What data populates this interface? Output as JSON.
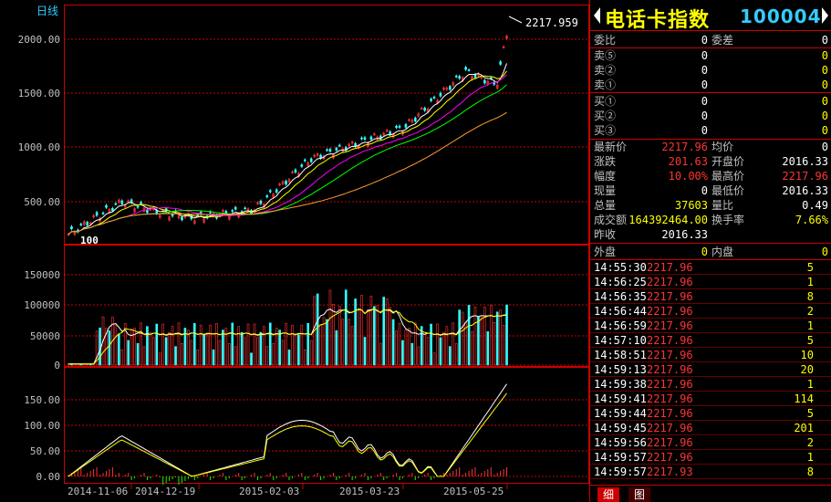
{
  "chart_header": {
    "period_label": "日线",
    "last_price_label": "2217.959",
    "start_label": "100"
  },
  "price_axis": [
    "2000.00",
    "1500.00",
    "1000.00",
    "500.00"
  ],
  "volume_axis": [
    "150000",
    "100000",
    "50000",
    "0"
  ],
  "indicator_axis": [
    "150.00",
    "100.00",
    "50.00",
    "0.00"
  ],
  "date_axis": [
    "2014-11-06",
    "2014-12-19",
    "2015-02-03",
    "2015-03-23",
    "2015-05-25"
  ],
  "colors": {
    "up": "#ff3333",
    "down": "#33ffff",
    "grid": "#cc0000",
    "ma5": "#ffffff",
    "ma10": "#ffff00",
    "ma20": "#ff00ff",
    "ma30": "#00ff00",
    "ma60": "#ff9933"
  },
  "title": {
    "name": "电话卡指数",
    "code": "100004"
  },
  "order_book": {
    "weibi_label": "委比",
    "weibi": "0",
    "weicha_label": "委差",
    "weicha": "0",
    "sells": [
      {
        "label": "卖⑤",
        "price": "0",
        "vol": "0"
      },
      {
        "label": "卖②",
        "price": "0",
        "vol": "0"
      },
      {
        "label": "卖①",
        "price": "0",
        "vol": "0"
      }
    ],
    "buys": [
      {
        "label": "买①",
        "price": "0",
        "vol": "0"
      },
      {
        "label": "买②",
        "price": "0",
        "vol": "0"
      },
      {
        "label": "买③",
        "price": "0",
        "vol": "0"
      }
    ]
  },
  "quote": {
    "latest_label": "最新价",
    "latest": "2217.96",
    "avg_label": "均价",
    "avg": "0",
    "change_label": "涨跌",
    "change": "201.63",
    "open_label": "开盘价",
    "open": "2016.33",
    "pct_label": "幅度",
    "pct": "10.00%",
    "high_label": "最高价",
    "high": "2217.96",
    "cur_label": "现量",
    "cur": "0",
    "low_label": "最低价",
    "low": "2016.33",
    "total_label": "总量",
    "total": "37603",
    "ratio_label": "量比",
    "ratio": "0.49",
    "amount_label": "成交额",
    "amount": "164392464.00",
    "turnover_label": "换手率",
    "turnover": "7.66%",
    "prev_label": "昨收",
    "prev": "2016.33",
    "outer_label": "外盘",
    "outer": "0",
    "inner_label": "内盘",
    "inner": "0"
  },
  "ticks": [
    {
      "time": "14:55:30",
      "price": "2217.96",
      "vol": "5"
    },
    {
      "time": "14:56:25",
      "price": "2217.96",
      "vol": "1"
    },
    {
      "time": "14:56:35",
      "price": "2217.96",
      "vol": "8"
    },
    {
      "time": "14:56:44",
      "price": "2217.96",
      "vol": "2"
    },
    {
      "time": "14:56:59",
      "price": "2217.96",
      "vol": "1"
    },
    {
      "time": "14:57:10",
      "price": "2217.96",
      "vol": "5"
    },
    {
      "time": "14:58:51",
      "price": "2217.96",
      "vol": "10"
    },
    {
      "time": "14:59:13",
      "price": "2217.96",
      "vol": "20"
    },
    {
      "time": "14:59:38",
      "price": "2217.96",
      "vol": "1"
    },
    {
      "time": "14:59:41",
      "price": "2217.96",
      "vol": "114"
    },
    {
      "time": "14:59:44",
      "price": "2217.96",
      "vol": "5"
    },
    {
      "time": "14:59:45",
      "price": "2217.96",
      "vol": "201"
    },
    {
      "time": "14:59:56",
      "price": "2217.96",
      "vol": "2"
    },
    {
      "time": "14:59:57",
      "price": "2217.96",
      "vol": "1"
    },
    {
      "time": "14:59:57",
      "price": "2217.93",
      "vol": "8"
    }
  ],
  "tabs": {
    "detail": "细",
    "chart": "图"
  }
}
